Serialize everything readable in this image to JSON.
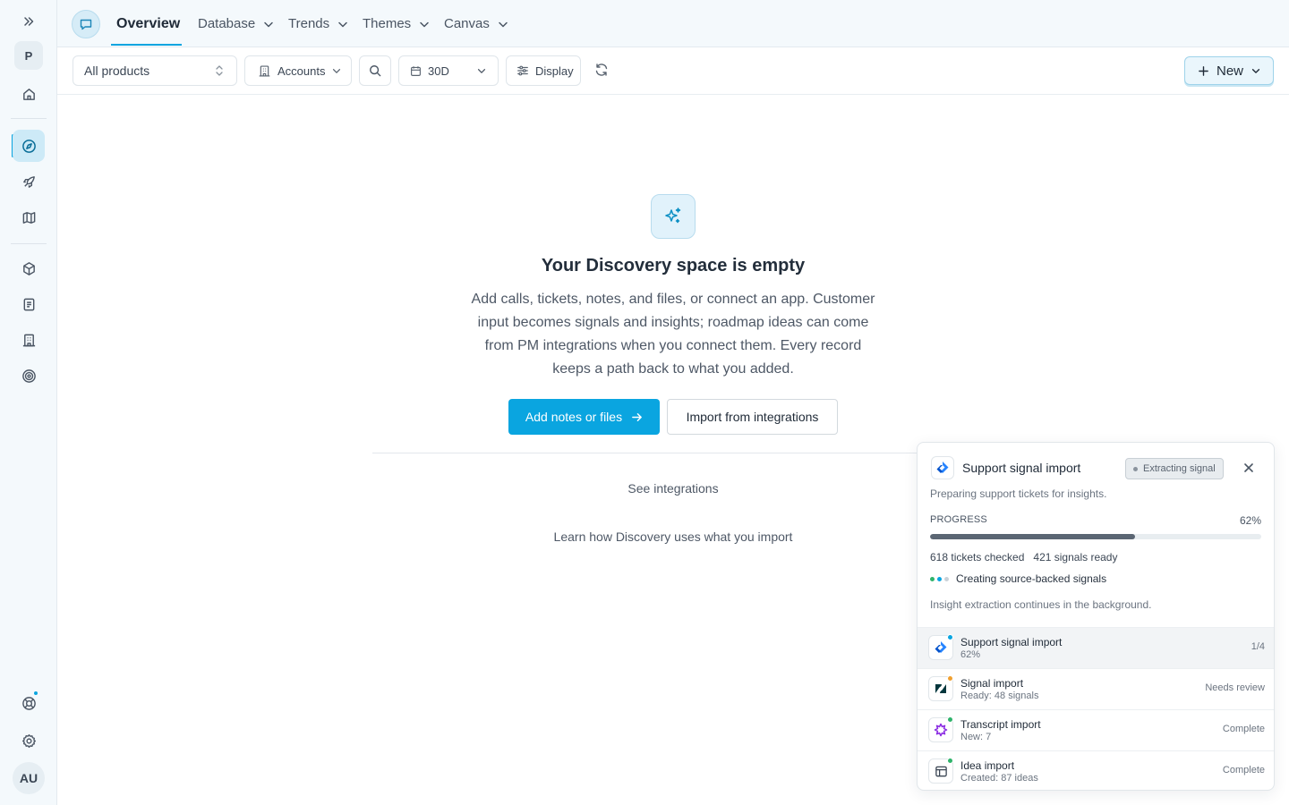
{
  "sidebar": {
    "workspace_initial": "P",
    "avatar_initials": "AU"
  },
  "nav": {
    "tabs": [
      {
        "label": "Overview",
        "active": true
      },
      {
        "label": "Database"
      },
      {
        "label": "Trends"
      },
      {
        "label": "Themes"
      },
      {
        "label": "Canvas"
      }
    ]
  },
  "toolbar": {
    "products_select": "All products",
    "accounts_label": "Accounts",
    "range_select": "30D",
    "display_label": "Display",
    "new_label": "New"
  },
  "empty_state": {
    "title": "Your Discovery space is empty",
    "description": "Add calls, tickets, notes, and files, or connect an app. Customer input becomes signals and insights; roadmap ideas can come from PM integrations when you connect them. Every record keeps a path back to what you added.",
    "primary_label": "Add notes or files",
    "secondary_label": "Import from integrations",
    "see_integrations": "See integrations",
    "learn_link": "Learn how Discovery uses what you import"
  },
  "import_panel": {
    "title": "Support signal import",
    "badge": "Extracting signal",
    "subtitle": "Preparing support tickets for insights.",
    "progress_label": "PROGRESS",
    "progress_pct_text": "62%",
    "progress_value": 0.62,
    "tickets_checked": "618 tickets checked",
    "signals_ready": "421 signals ready",
    "status_text": "Creating source-backed signals",
    "note": "Insight extraction continues in the background.",
    "rows": [
      {
        "name": "Support signal import",
        "meta": "62%",
        "status": "1/4",
        "dot": "#0aa5e0"
      },
      {
        "name": "Signal import",
        "meta": "Ready: 48 signals",
        "status": "Needs review",
        "dot": "#f0a030"
      },
      {
        "name": "Transcript import",
        "meta": "New: 7",
        "status": "Complete",
        "dot": "#2fb36b"
      },
      {
        "name": "Idea import",
        "meta": "Created: 87 ideas",
        "status": "Complete",
        "dot": "#2fb36b"
      }
    ]
  },
  "colors": {
    "accent": "#0aa5e0",
    "sidebar_bg": "#f4f9fc",
    "progress_fill": "#5b6673"
  }
}
